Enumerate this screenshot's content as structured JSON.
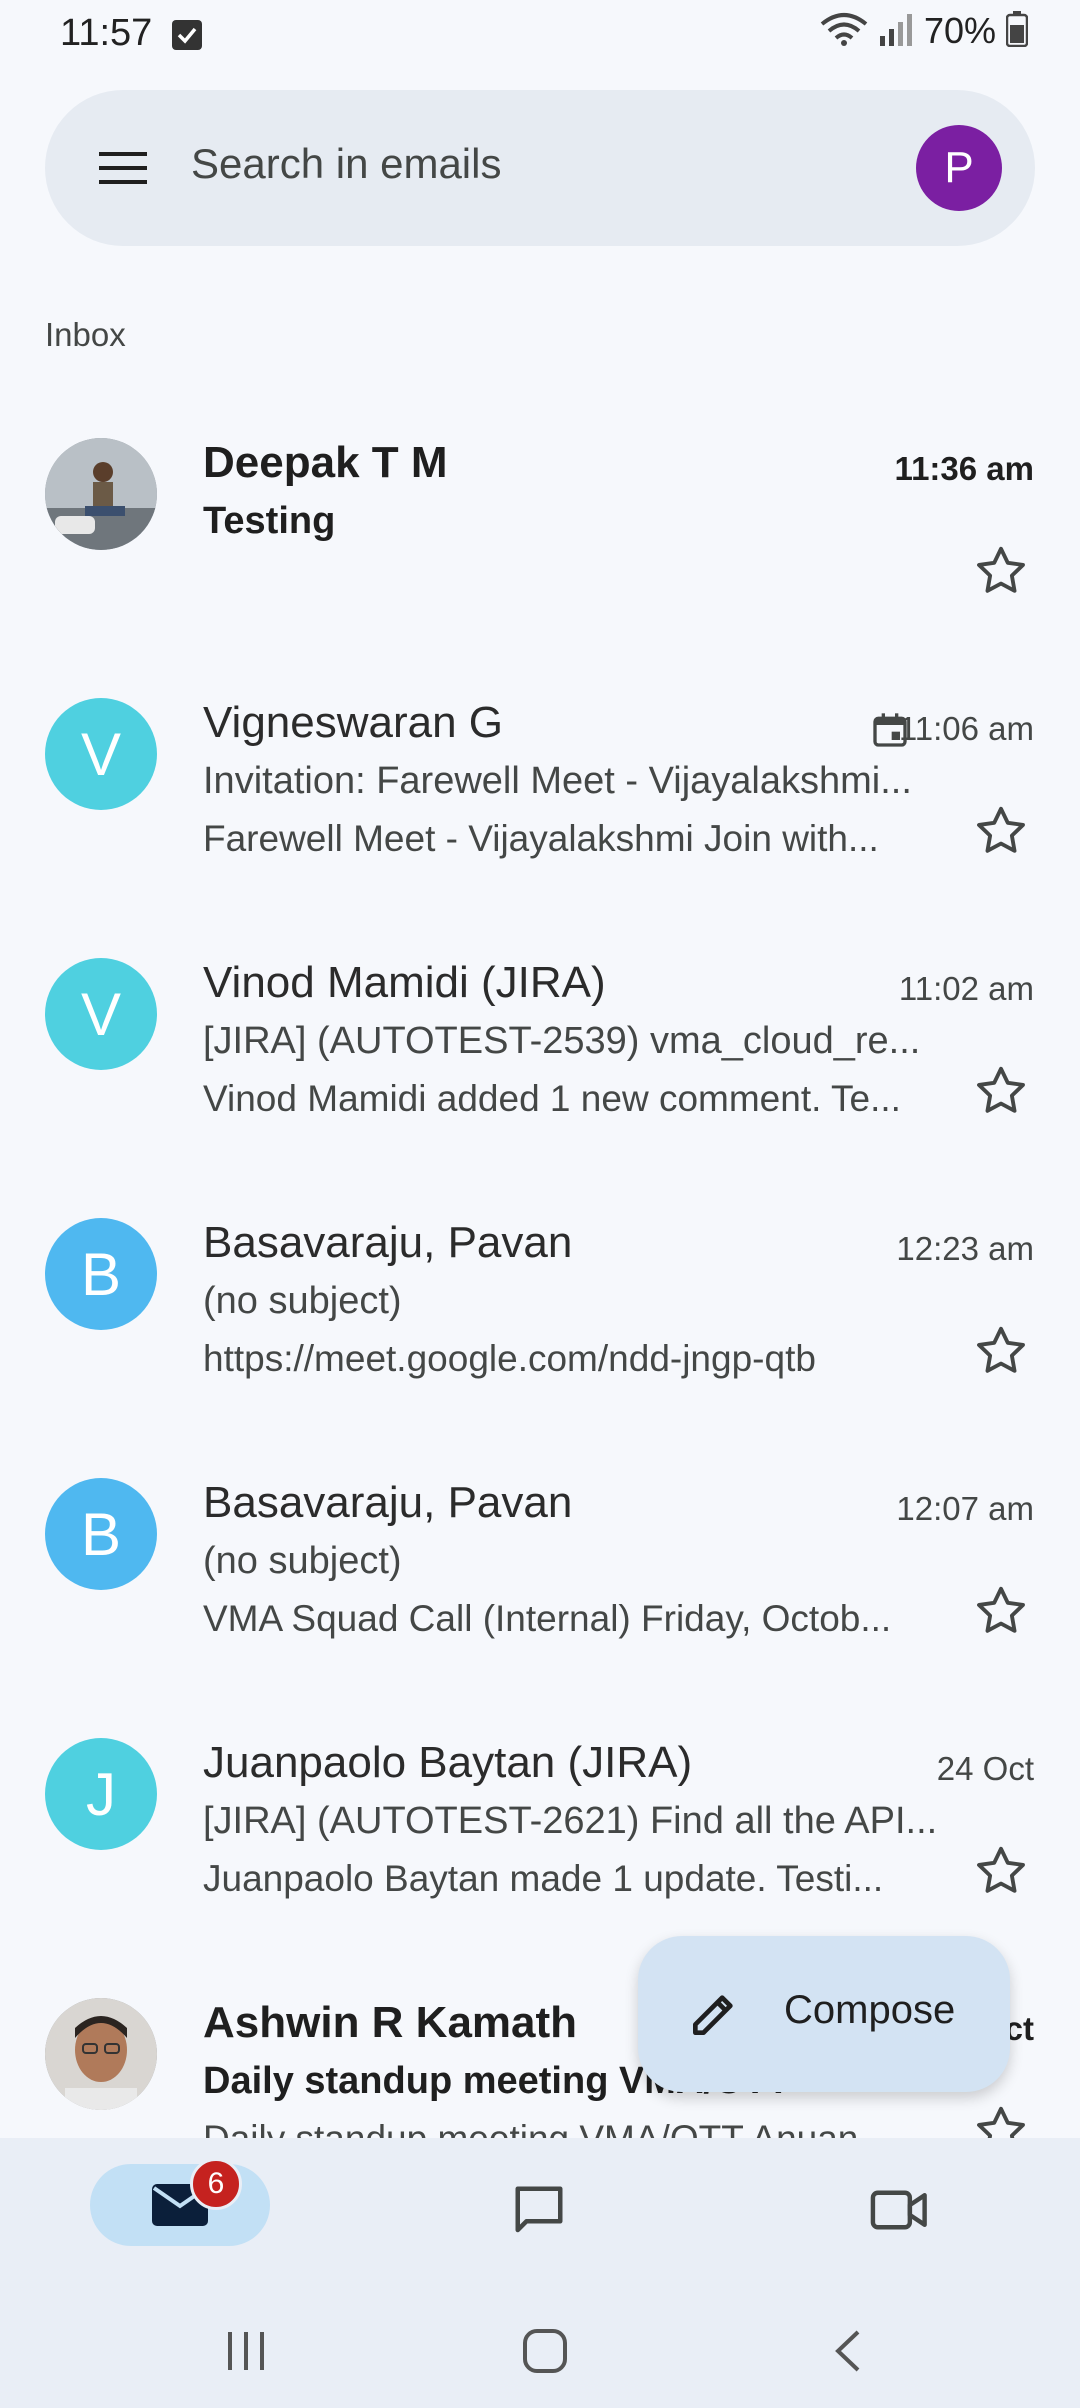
{
  "status": {
    "time": "11:57",
    "battery": "70%"
  },
  "search": {
    "placeholder": "Search in emails",
    "account_initial": "P"
  },
  "folder": {
    "label": "Inbox"
  },
  "emails": [
    {
      "sender": "Deepak T M",
      "subject": "Testing",
      "snippet": "",
      "time": "11:36 am",
      "unread": true,
      "avatar": "photo",
      "starred": false
    },
    {
      "sender": "Vigneswaran G",
      "subject": "Invitation: Farewell Meet - Vijayalakshmi...",
      "snippet": "Farewell Meet - Vijayalakshmi Join with...",
      "time": "11:06 am",
      "unread": false,
      "avatar_initial": "V",
      "avatar_color": "#4fd0e0",
      "calendar_icon": true
    },
    {
      "sender": "Vinod Mamidi (JIRA)",
      "subject": "[JIRA] (AUTOTEST-2539) vma_cloud_re...",
      "snippet": "Vinod Mamidi added 1 new comment. Te...",
      "time": "11:02 am",
      "unread": false,
      "avatar_initial": "V",
      "avatar_color": "#4fd0e0"
    },
    {
      "sender": "Basavaraju, Pavan",
      "subject": "(no subject)",
      "snippet": "https://meet.google.com/ndd-jngp-qtb",
      "time": "12:23 am",
      "unread": false,
      "avatar_initial": "B",
      "avatar_color": "#4fb8f0"
    },
    {
      "sender": "Basavaraju, Pavan",
      "subject": "(no subject)",
      "snippet": "VMA Squad Call (Internal) Friday, Octob...",
      "time": "12:07 am",
      "unread": false,
      "avatar_initial": "B",
      "avatar_color": "#4fb8f0"
    },
    {
      "sender": "Juanpaolo Baytan (JIRA)",
      "subject": "[JIRA] (AUTOTEST-2621) Find all the API...",
      "snippet": "Juanpaolo Baytan made 1 update. Testi...",
      "time": "24 Oct",
      "unread": false,
      "avatar_initial": "J",
      "avatar_color": "#4fd0e0"
    },
    {
      "sender": "Ashwin R Kamath",
      "subject": "Daily standup meeting VMA/OTT",
      "snippet": "Daily standup meeting VMA/OTT Anuan...",
      "time": "Oct",
      "unread": true,
      "avatar": "photo"
    }
  ],
  "compose": {
    "label": "Compose"
  },
  "nav": {
    "mail_badge": "6"
  },
  "colors": {
    "background": "#f6f8fc",
    "accent": "#7b1fa2",
    "badge": "#c5221f"
  }
}
